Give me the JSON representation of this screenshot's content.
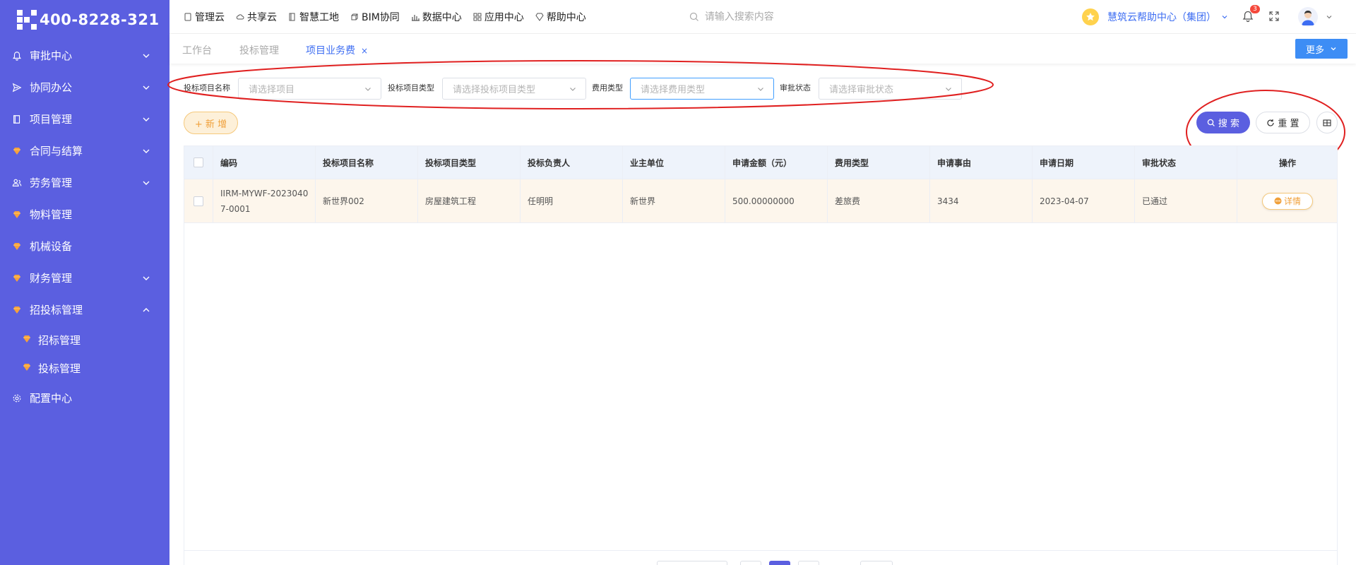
{
  "sidebar": {
    "logo_text": "400-8228-321",
    "items": [
      {
        "label": "审批中心",
        "icon": "bell-icon",
        "expanded": false
      },
      {
        "label": "协同办公",
        "icon": "send-icon",
        "expanded": false
      },
      {
        "label": "项目管理",
        "icon": "book-icon",
        "expanded": false
      },
      {
        "label": "合同与结算",
        "icon": "gem-icon",
        "expanded": false
      },
      {
        "label": "劳务管理",
        "icon": "users-icon",
        "expanded": false
      },
      {
        "label": "物料管理",
        "icon": "gem-icon"
      },
      {
        "label": "机械设备",
        "icon": "gem-icon"
      },
      {
        "label": "财务管理",
        "icon": "gem-icon",
        "expanded": false
      },
      {
        "label": "招投标管理",
        "icon": "gem-icon",
        "expanded": true
      },
      {
        "label": "配置中心",
        "icon": "gear-icon"
      }
    ],
    "subitems": [
      {
        "label": "招标管理",
        "icon": "gem-icon"
      },
      {
        "label": "投标管理",
        "icon": "gem-icon"
      }
    ]
  },
  "topnav": {
    "items": [
      {
        "label": "管理云",
        "icon": "tablet-icon"
      },
      {
        "label": "共享云",
        "icon": "cloud-icon"
      },
      {
        "label": "智慧工地",
        "icon": "book-icon"
      },
      {
        "label": "BIM协同",
        "icon": "cube-icon"
      },
      {
        "label": "数据中心",
        "icon": "bar-chart-icon"
      },
      {
        "label": "应用中心",
        "icon": "grid-icon"
      },
      {
        "label": "帮助中心",
        "icon": "diamond-icon"
      }
    ],
    "search_placeholder": "请输入搜索内容",
    "org_name": "慧筑云帮助中心（集团）",
    "notification_count": "3"
  },
  "tabs": {
    "items": [
      {
        "label": "工作台",
        "active": false
      },
      {
        "label": "投标管理",
        "active": false
      },
      {
        "label": "项目业务费",
        "active": true,
        "close": "×"
      }
    ],
    "more_label": "更多"
  },
  "filters": [
    {
      "label": "投标项目名称",
      "placeholder": "请选择项目"
    },
    {
      "label": "投标项目类型",
      "placeholder": "请选择投标项目类型"
    },
    {
      "label": "费用类型",
      "placeholder": "请选择费用类型",
      "focused": true
    },
    {
      "label": "审批状态",
      "placeholder": "请选择审批状态"
    }
  ],
  "actions": {
    "add_label": "+ 新 增",
    "search_label": "搜 索",
    "reset_label": "重 置"
  },
  "table": {
    "columns": [
      "编码",
      "投标项目名称",
      "投标项目类型",
      "投标负责人",
      "业主单位",
      "申请金额（元）",
      "费用类型",
      "申请事由",
      "申请日期",
      "审批状态",
      "操作"
    ],
    "rows": [
      {
        "code_line1": "IIRM-MYWF-2023040",
        "code_line2": "7-0001",
        "project_name": "新世界002",
        "project_type": "房屋建筑工程",
        "owner": "任明明",
        "client": "新世界",
        "amount": "500.00000000",
        "fee_type": "差旅费",
        "reason": "3434",
        "date": "2023-04-07",
        "status": "已通过",
        "action_label": "详情"
      }
    ]
  },
  "colors": {
    "sidebar_bg": "#5b5fe0",
    "accent_blue": "#3d6df2",
    "annotation_red": "#e02020",
    "row_highlight": "#fdf6ec",
    "add_orange": "#f0a03a"
  }
}
